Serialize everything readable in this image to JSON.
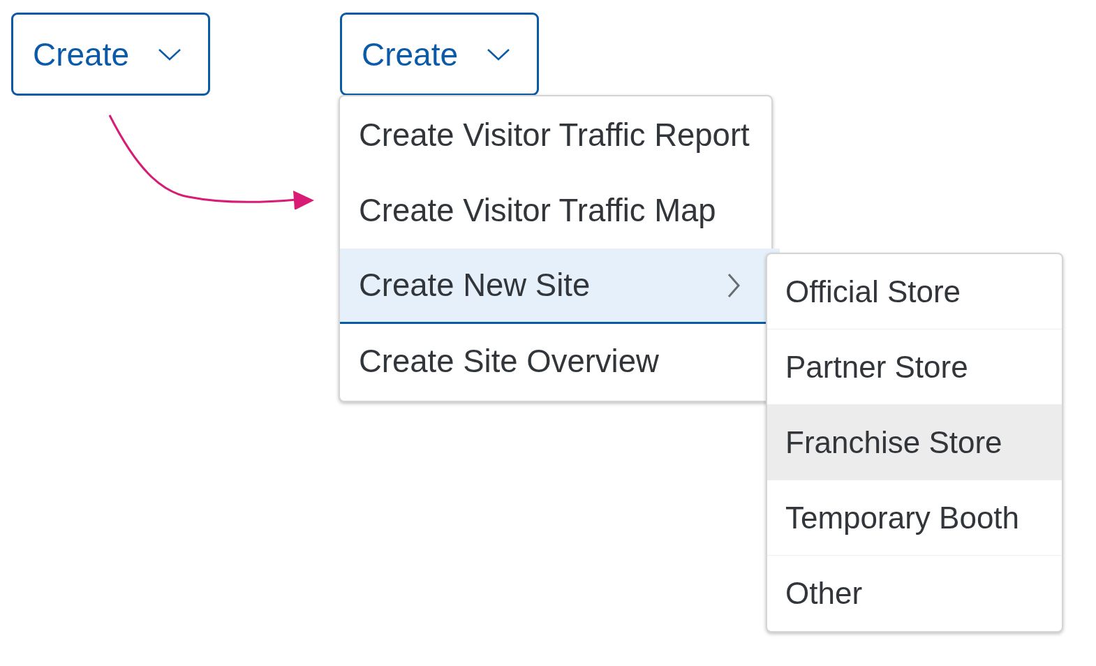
{
  "buttons": [
    {
      "label": "Create"
    },
    {
      "label": "Create"
    }
  ],
  "menu": {
    "items": [
      {
        "label": "Create Visitor Traffic Report",
        "selected": false,
        "has_submenu": false
      },
      {
        "label": "Create Visitor Traffic Map",
        "selected": false,
        "has_submenu": false
      },
      {
        "label": "Create New Site",
        "selected": true,
        "has_submenu": true
      },
      {
        "label": "Create Site Overview",
        "selected": false,
        "has_submenu": false
      }
    ]
  },
  "submenu": {
    "items": [
      {
        "label": "Official Store",
        "hovered": false
      },
      {
        "label": "Partner Store",
        "hovered": false
      },
      {
        "label": "Franchise Store",
        "hovered": true
      },
      {
        "label": "Temporary Booth",
        "hovered": false
      },
      {
        "label": "Other",
        "hovered": false
      }
    ]
  }
}
